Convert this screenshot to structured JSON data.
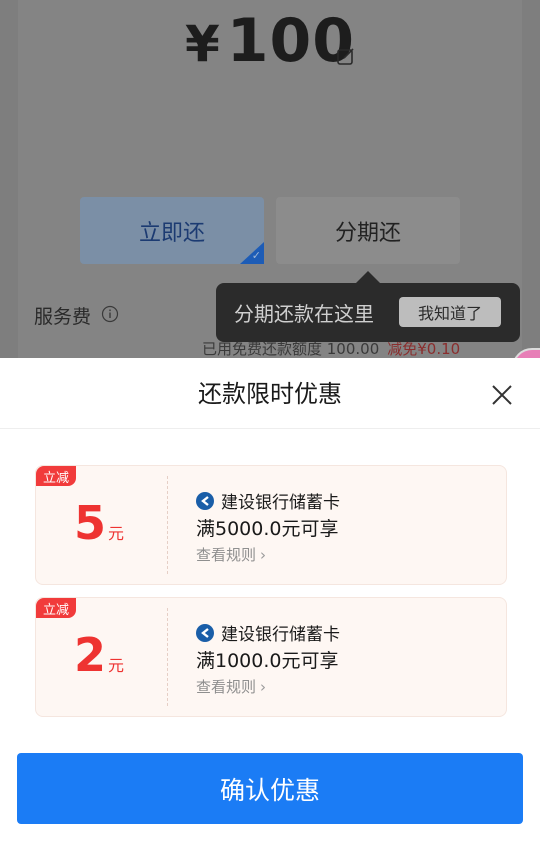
{
  "background": {
    "amount_symbol": "¥",
    "amount_value": "100",
    "options": {
      "repay_now": "立即还",
      "installment": "分期还"
    },
    "fee_label": "服务费",
    "quota_text": "已用免费还款额度 100.00",
    "discount_text": "减免¥0.10",
    "tooltip": {
      "text": "分期还款在这里",
      "button": "我知道了"
    }
  },
  "sheet": {
    "title": "还款限时优惠",
    "coupons": [
      {
        "tag": "立减",
        "amount": "5",
        "unit": "元",
        "bank": "建设银行储蓄卡",
        "condition": "满5000.0元可享",
        "rules": "查看规则"
      },
      {
        "tag": "立减",
        "amount": "2",
        "unit": "元",
        "bank": "建设银行储蓄卡",
        "condition": "满1000.0元可享",
        "rules": "查看规则"
      }
    ],
    "confirm_label": "确认优惠"
  },
  "colors": {
    "accent": "#1b7cf5",
    "discount_red": "#ee3331",
    "tag_red": "#f13b3b"
  }
}
